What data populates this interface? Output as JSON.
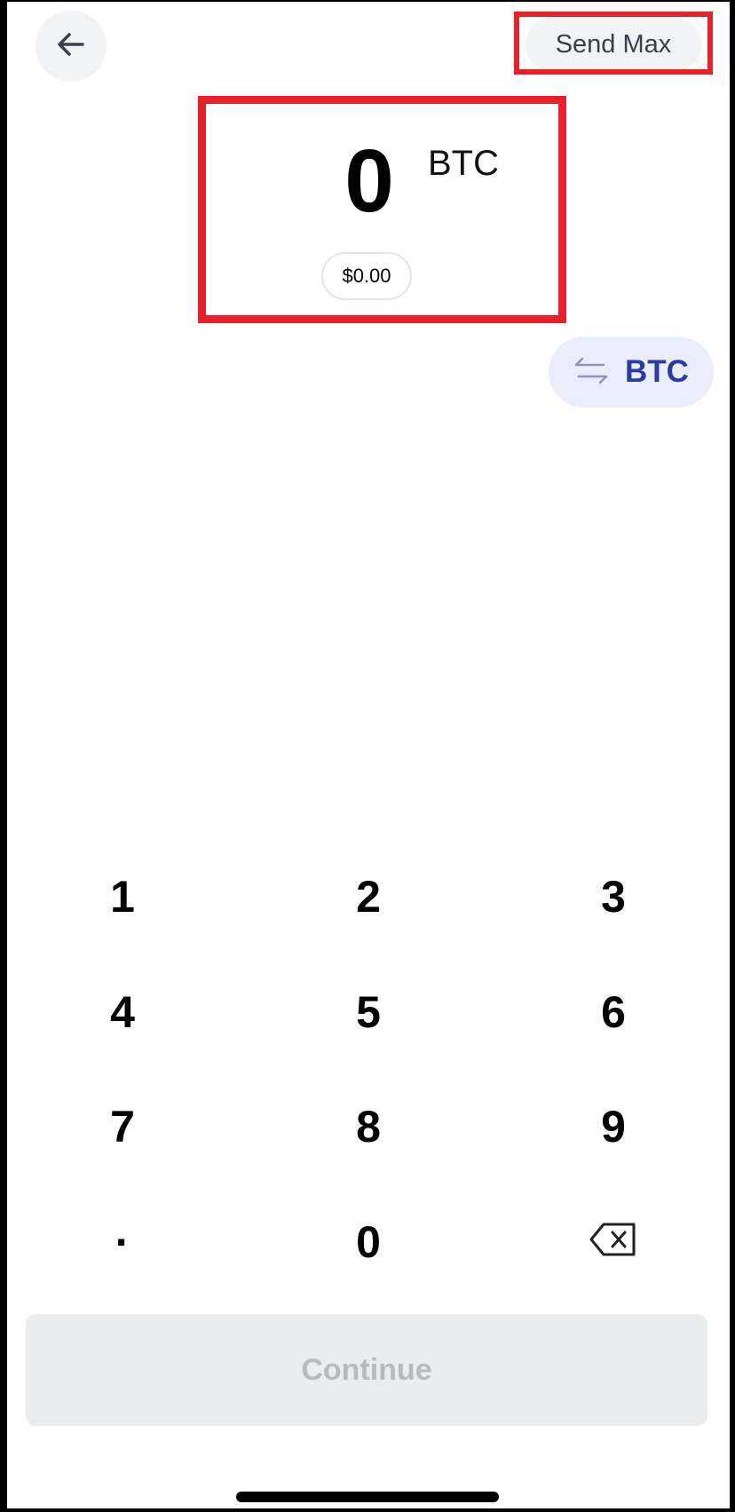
{
  "header": {
    "send_max_label": "Send Max"
  },
  "amount": {
    "value": "0",
    "unit": "BTC",
    "fiat_value": "$0.00"
  },
  "currency_toggle": {
    "label": "BTC",
    "icon": "swap-arrows-icon"
  },
  "keypad": {
    "keys": [
      "1",
      "2",
      "3",
      "4",
      "5",
      "6",
      "7",
      "8",
      "9",
      "·",
      "0",
      "⌫"
    ],
    "backspace_icon": "backspace-icon"
  },
  "continue_label": "Continue",
  "colors": {
    "highlight": "#e8202a",
    "accent": "#2b3ba3",
    "accent_bg": "#eaedfb",
    "button_bg": "#f2f3f5",
    "disabled_text": "#b8babd"
  }
}
